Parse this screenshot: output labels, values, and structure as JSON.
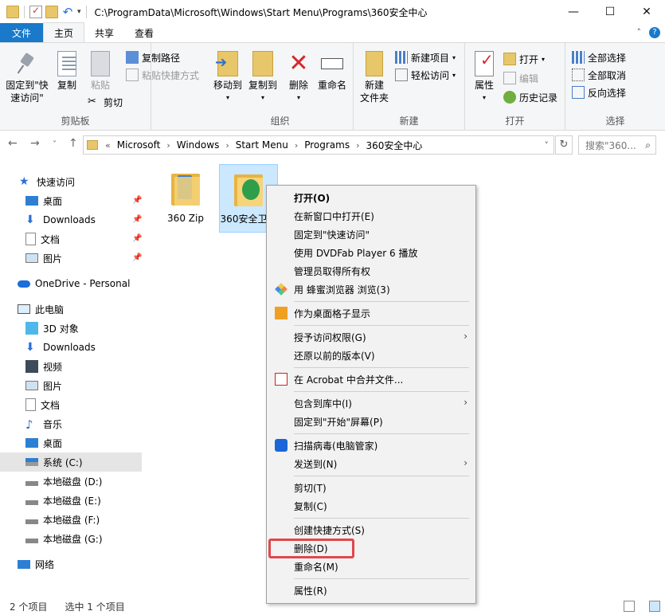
{
  "titlebar": {
    "path": "C:\\ProgramData\\Microsoft\\Windows\\Start Menu\\Programs\\360安全中心",
    "minimize": "—",
    "maximize": "☐",
    "close": "✕"
  },
  "tabs": {
    "file": "文件",
    "home": "主页",
    "share": "共享",
    "view": "查看",
    "collapse": "˄",
    "help": "?"
  },
  "ribbon": {
    "clipboard": {
      "label": "剪贴板",
      "pin": "固定到\"快速访问\"",
      "copy": "复制",
      "paste": "粘贴",
      "copy_path": "复制路径",
      "paste_shortcut": "粘贴快捷方式",
      "cut": "剪切"
    },
    "organize": {
      "label": "组织",
      "move_to": "移动到",
      "copy_to": "复制到",
      "delete": "删除",
      "rename": "重命名"
    },
    "new": {
      "label": "新建",
      "new_folder": "新建\n文件夹",
      "new_item": "新建项目",
      "easy_access": "轻松访问"
    },
    "open": {
      "label": "打开",
      "properties": "属性",
      "open": "打开",
      "edit": "编辑",
      "history": "历史记录"
    },
    "select": {
      "label": "选择",
      "select_all": "全部选择",
      "select_none": "全部取消",
      "invert": "反向选择"
    }
  },
  "address": {
    "back": "←",
    "forward": "→",
    "recent": "˅",
    "up": "↑",
    "overflow": "«",
    "crumbs": [
      "Microsoft",
      "Windows",
      "Start Menu",
      "Programs",
      "360安全中心"
    ],
    "dropdown": "˅",
    "refresh": "↻",
    "search_placeholder": "搜索\"360..."
  },
  "navpane": {
    "quick_access": "快速访问",
    "desktop": "桌面",
    "downloads": "Downloads",
    "documents": "文档",
    "pictures": "图片",
    "onedrive": "OneDrive - Personal",
    "this_pc": "此电脑",
    "objects3d": "3D 对象",
    "downloads2": "Downloads",
    "videos": "视频",
    "pictures2": "图片",
    "documents2": "文档",
    "music": "音乐",
    "desktop2": "桌面",
    "drive_c": "系统 (C:)",
    "drive_d": "本地磁盘 (D:)",
    "drive_e": "本地磁盘 (E:)",
    "drive_f": "本地磁盘 (F:)",
    "drive_g": "本地磁盘 (G:)",
    "network": "网络"
  },
  "files": [
    {
      "name": "360 Zip"
    },
    {
      "name": "360安全卫士"
    }
  ],
  "context_menu": {
    "open": "打开(O)",
    "open_new_window": "在新窗口中打开(E)",
    "pin_quick": "固定到\"快速访问\"",
    "dvdfab": "使用 DVDFab Player 6 播放",
    "take_ownership": "管理员取得所有权",
    "browser": "用 蜂蜜浏览器 浏览(3)",
    "desktop_grid": "作为桌面格子显示",
    "grant_access": "授予访问权限(G)",
    "restore": "还原以前的版本(V)",
    "acrobat": "在 Acrobat 中合并文件...",
    "include_library": "包含到库中(I)",
    "pin_start": "固定到\"开始\"屏幕(P)",
    "scan": "扫描病毒(电脑管家)",
    "send_to": "发送到(N)",
    "cut": "剪切(T)",
    "copy": "复制(C)",
    "create_shortcut": "创建快捷方式(S)",
    "delete": "删除(D)",
    "rename": "重命名(M)",
    "properties": "属性(R)"
  },
  "status": {
    "count": "2 个项目",
    "selected": "选中 1 个项目"
  },
  "colors": {
    "accent": "#1979ca",
    "highlight": "#e0474c",
    "selection": "#cce8ff"
  }
}
